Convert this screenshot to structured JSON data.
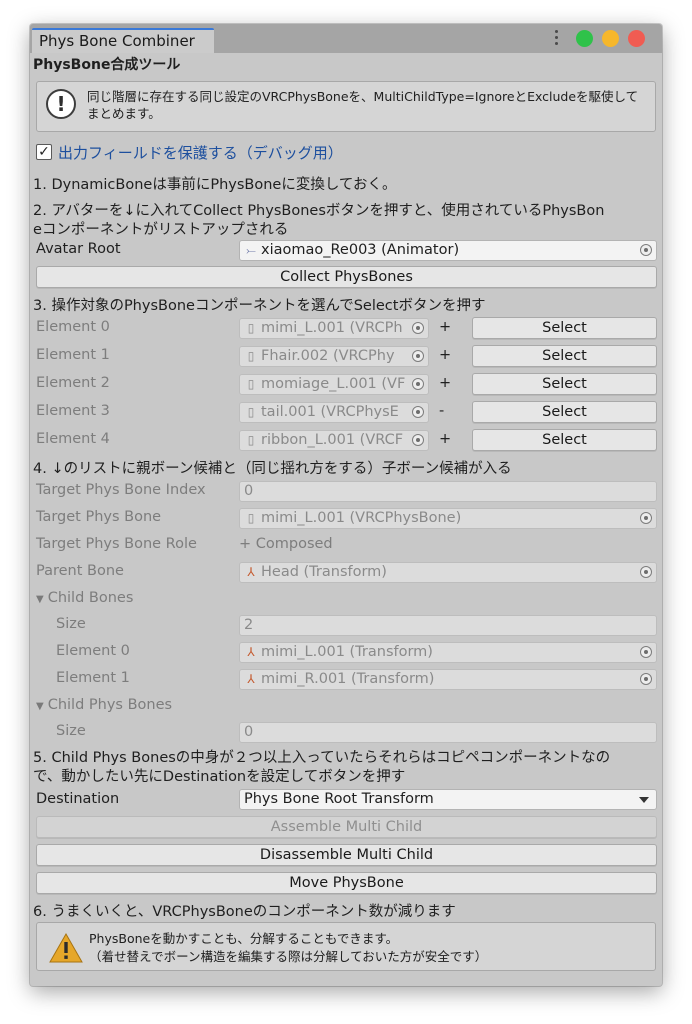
{
  "window": {
    "tab_title": "Phys Bone Combiner",
    "heading": "PhysBone合成ツール",
    "info": "同じ階層に存在する同じ設定のVRCPhysBoneを、MultiChildType=IgnoreとExcludeを駆使してまとめます。",
    "protect_checkbox": {
      "label": "出力フィールドを保護する（デバッグ用）",
      "checked": true
    }
  },
  "steps": {
    "s1": "1. DynamicBoneは事前にPhysBoneに変換しておく。",
    "s2_line1": "2. アバターを↓に入れてCollect PhysBonesボタンを押すと、使用されているPhysBon",
    "s2_line2": "eコンポーネントがリストアップされる",
    "s3": "3. 操作対象のPhysBoneコンポーネントを選んでSelectボタンを押す",
    "s4": "4. ↓のリストに親ボーン候補と（同じ揺れ方をする）子ボーン候補が入る",
    "s5_line1": "5. Child Phys Bonesの中身が２つ以上入っていたらそれらはコピペコンポーネントなの",
    "s5_line2": "で、動かしたい先にDestinationを設定してボタンを押す",
    "s6": "6. うまくいくと、VRCPhysBoneのコンポーネント数が減ります"
  },
  "avatar": {
    "label": "Avatar Root",
    "value": "xiaomao_Re003 (Animator)",
    "collect_button": "Collect PhysBones"
  },
  "elements": [
    {
      "label": "Element 0",
      "value": "mimi_L.001 (VRCPh",
      "sign": "+",
      "button": "Select"
    },
    {
      "label": "Element 1",
      "value": "Fhair.002 (VRCPhy",
      "sign": "+",
      "button": "Select"
    },
    {
      "label": "Element 2",
      "value": "momiage_L.001 (VF",
      "sign": "+",
      "button": "Select"
    },
    {
      "label": "Element 3",
      "value": "tail.001 (VRCPhysE",
      "sign": "-",
      "button": "Select"
    },
    {
      "label": "Element 4",
      "value": "ribbon_L.001 (VRCF",
      "sign": "+",
      "button": "Select"
    }
  ],
  "target": {
    "index_label": "Target Phys Bone Index",
    "index_value": "0",
    "bone_label": "Target Phys Bone",
    "bone_value": "mimi_L.001 (VRCPhysBone)",
    "role_label": "Target Phys Bone Role",
    "role_value": "+ Composed",
    "parent_label": "Parent Bone",
    "parent_value": "Head (Transform)"
  },
  "child_bones": {
    "label": "Child Bones",
    "size_label": "Size",
    "size_value": "2",
    "items": [
      {
        "label": "Element 0",
        "value": "mimi_L.001 (Transform)"
      },
      {
        "label": "Element 1",
        "value": "mimi_R.001 (Transform)"
      }
    ]
  },
  "child_phys_bones": {
    "label": "Child Phys Bones",
    "size_label": "Size",
    "size_value": "0"
  },
  "destination": {
    "label": "Destination",
    "value": "Phys Bone Root Transform"
  },
  "buttons": {
    "assemble": "Assemble Multi Child",
    "disassemble": "Disassemble Multi Child",
    "move": "Move PhysBone"
  },
  "warning": {
    "line1": "PhysBoneを動かすことも、分解することもできます。",
    "line2": "（着せ替えでボーン構造を編集する際は分解しておいた方が安全です）"
  },
  "colors": {
    "tab_accent": "#3a79d8",
    "checkbox_label": "#1d4f9e",
    "close": "#f05c52",
    "minimize": "#f6b72b",
    "maximize": "#2fc24a",
    "warning": "#e6a72a"
  }
}
